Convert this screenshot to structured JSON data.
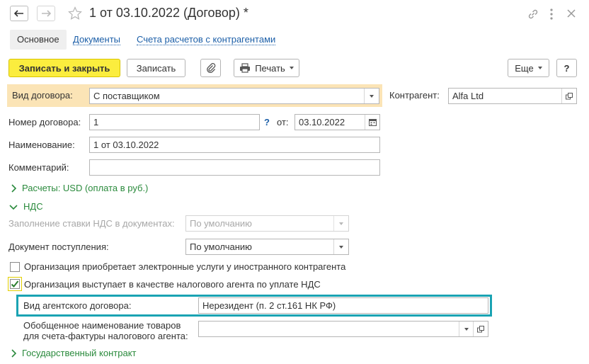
{
  "window": {
    "title": "1 от 03.10.2022 (Договор) *"
  },
  "tabs": [
    {
      "label": "Основное"
    },
    {
      "label": "Документы"
    },
    {
      "label": "Счета расчетов с контрагентами"
    }
  ],
  "toolbar": {
    "save_close": "Записать и закрыть",
    "save": "Записать",
    "print": "Печать",
    "more": "Еще",
    "help": "?"
  },
  "form": {
    "contract_type_label": "Вид договора:",
    "contract_type_value": "С поставщиком",
    "counterparty_label": "Контрагент:",
    "counterparty_value": "Alfa Ltd",
    "number_label": "Номер договора:",
    "number_value": "1",
    "question": "?",
    "from_label": "от:",
    "date_value": "03.10.2022",
    "name_label": "Наименование:",
    "name_value": "1 от 03.10.2022",
    "comment_label": "Комментарий:",
    "comment_value": ""
  },
  "settlements_group": "Расчеты: USD (оплата в руб.)",
  "vat_group": "НДС",
  "vat": {
    "rate_fill_label": "Заполнение ставки НДС в документах:",
    "rate_fill_value": "По умолчанию",
    "receipt_doc_label": "Документ поступления:",
    "receipt_doc_value": "По умолчанию",
    "e_services_label": "Организация приобретает электронные услуги у иностранного контрагента",
    "e_services_checked": false,
    "tax_agent_label": "Организация выступает в качестве налогового агента по уплате НДС",
    "tax_agent_checked": true,
    "agent_contract_type_label": "Вид агентского договора:",
    "agent_contract_type_value": "Нерезидент (п. 2 ст.161 НК РФ)",
    "goods_name_label_1": "Обобщенное наименование товаров",
    "goods_name_label_2": "для счета-фактуры налогового агента:",
    "goods_name_value": ""
  },
  "state_contract_group": "Государственный контракт",
  "colors": {
    "accent_yellow": "#fbed3e",
    "highlight_row": "#fbe4b6",
    "link_blue": "#1c5fa8",
    "group_green": "#2a8a3c",
    "focus_teal": "#1aa3b3"
  }
}
